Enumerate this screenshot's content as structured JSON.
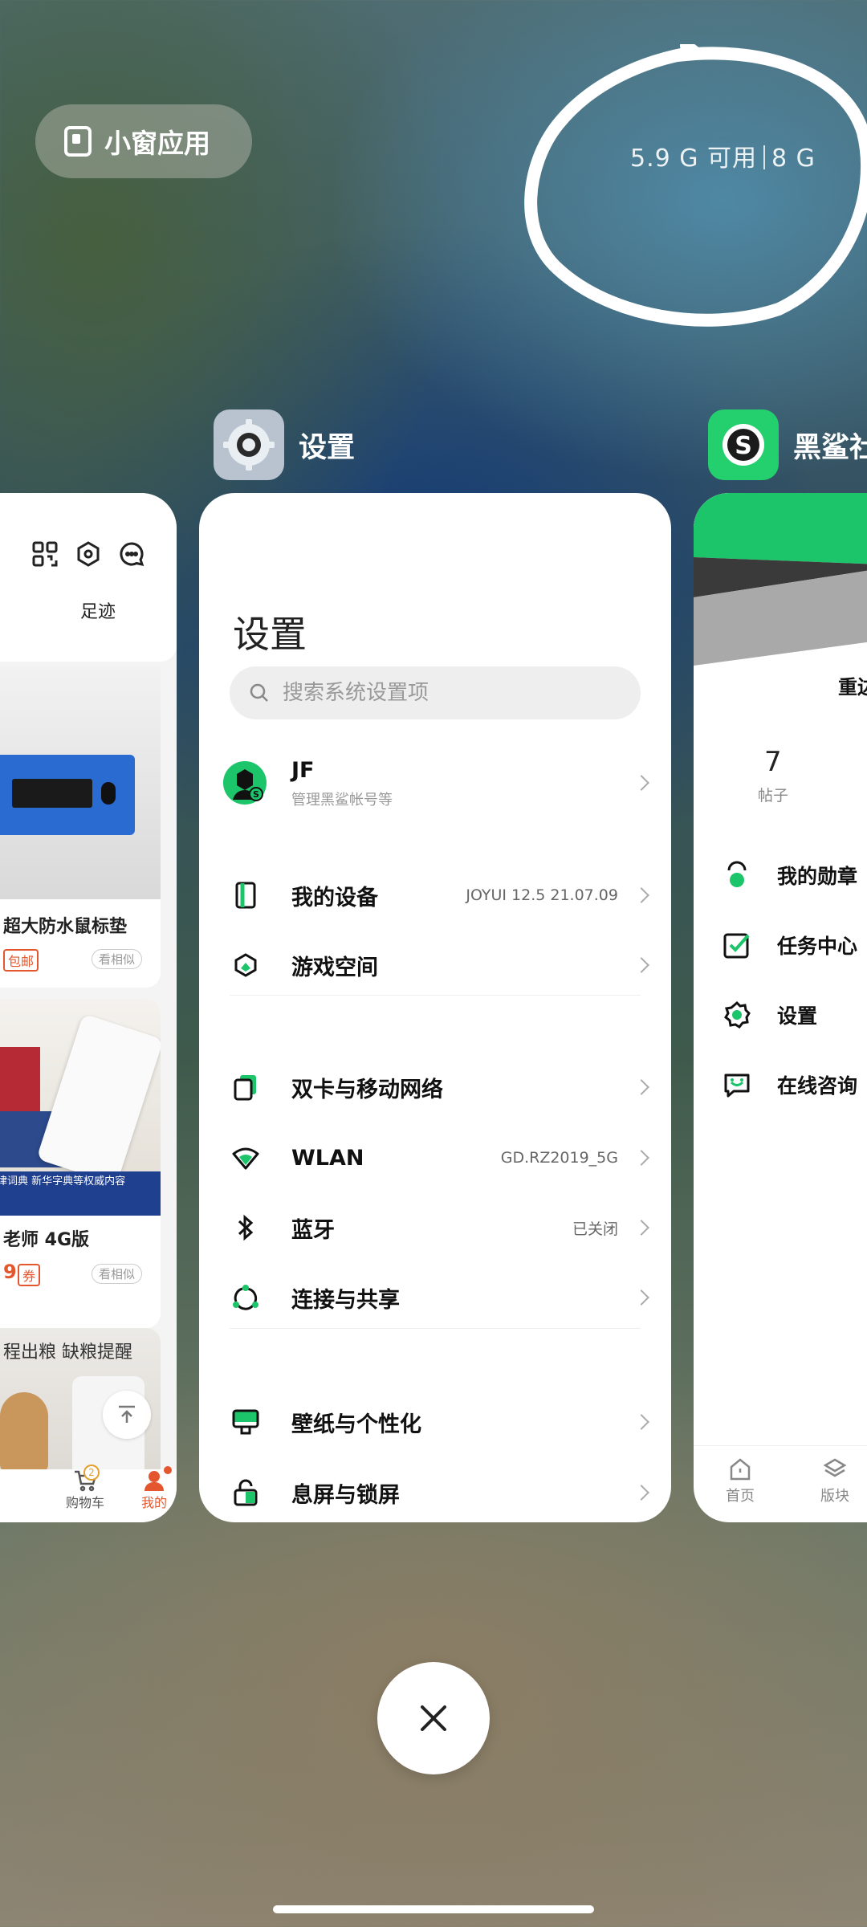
{
  "top": {
    "small_window_label": "小窗应用",
    "memory_available": "5.9 G 可用",
    "memory_total": "8 G"
  },
  "apps": {
    "settings_name": "设置",
    "blackshark_name": "黑鲨社"
  },
  "left_card": {
    "footprint": "足迹",
    "product1_title": "超大防水鼠标垫",
    "product1_tag": "包邮",
    "similar_label": "看相似",
    "product2_banner": "律词典 新华字典等权威内容",
    "product2_title": "老师 4G版",
    "product2_price": "9",
    "product2_coupon": "券",
    "product3_title": "程出粮 缺粮提醒",
    "cart_count": "2",
    "tab_cart": "购物车",
    "tab_mine": "我的"
  },
  "settings_card": {
    "title": "设置",
    "search_placeholder": "搜索系统设置项",
    "account_name": "JF",
    "account_sub": "管理黑鲨帐号等",
    "items": [
      {
        "label": "我的设备",
        "value": "JOYUI 12.5 21.07.09"
      },
      {
        "label": "游戏空间",
        "value": ""
      },
      {
        "label": "双卡与移动网络",
        "value": ""
      },
      {
        "label": "WLAN",
        "value": "GD.RZ2019_5G"
      },
      {
        "label": "蓝牙",
        "value": "已关闭"
      },
      {
        "label": "连接与共享",
        "value": ""
      },
      {
        "label": "壁纸与个性化",
        "value": ""
      },
      {
        "label": "息屏与锁屏",
        "value": ""
      }
    ]
  },
  "right_card": {
    "button_text": "重边",
    "stat_number": "7",
    "stat_label": "帖子",
    "menu": [
      "我的勋章",
      "任务中心",
      "设置",
      "在线咨询"
    ],
    "tab_home": "首页",
    "tab_board": "版块"
  },
  "colors": {
    "accent_green": "#1cc46a",
    "accent_orange": "#e4572e"
  }
}
